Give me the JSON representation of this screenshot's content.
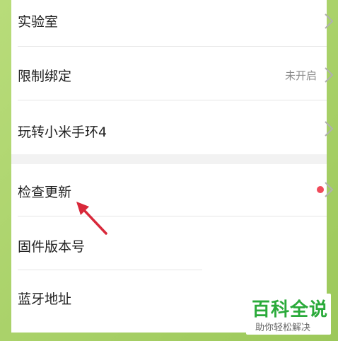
{
  "settings": {
    "rows": [
      {
        "label": "实验室",
        "value": ""
      },
      {
        "label": "限制绑定",
        "value": "未开启"
      },
      {
        "label": "玩转小米手环4",
        "value": ""
      },
      {
        "label": "检查更新",
        "value": ""
      },
      {
        "label": "固件版本号",
        "value": ""
      },
      {
        "label": "蓝牙地址",
        "value": ""
      }
    ],
    "update_badge_color": "#f04a5a"
  },
  "watermark": {
    "title": "百科全说",
    "subtitle": "助你轻松解决"
  },
  "colors": {
    "frame": "#a8d06a",
    "annotation_arrow": "#d8283a",
    "brand_green": "#2aaa3a"
  }
}
